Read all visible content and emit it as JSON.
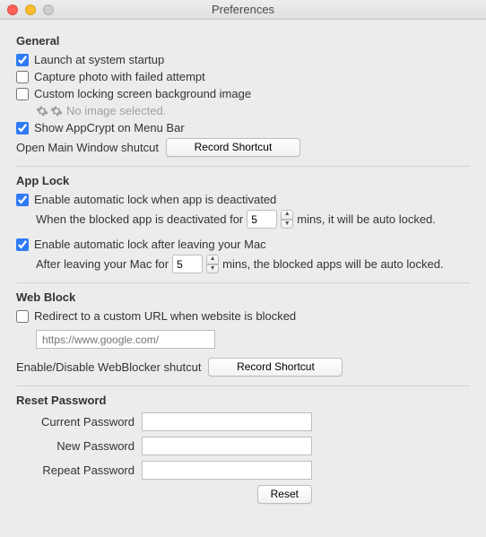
{
  "window": {
    "title": "Preferences"
  },
  "general": {
    "heading": "General",
    "launch": {
      "label": "Launch at system startup",
      "checked": true
    },
    "capture": {
      "label": "Capture photo with failed attempt",
      "checked": false
    },
    "customBg": {
      "label": "Custom locking screen background image",
      "checked": false
    },
    "noImage": "No image selected.",
    "menuBar": {
      "label": "Show AppCrypt on Menu Bar",
      "checked": true
    },
    "openShortcutLabel": "Open Main Window shutcut",
    "recordShortcut": "Record Shortcut"
  },
  "appLock": {
    "heading": "App Lock",
    "auto1": {
      "label": "Enable automatic lock when app is deactivated",
      "checked": true
    },
    "auto1_pre": "When the blocked app is deactivated for",
    "auto1_val": "5",
    "auto1_post": "mins, it will be auto locked.",
    "auto2": {
      "label": "Enable automatic lock after leaving your Mac",
      "checked": true
    },
    "auto2_pre": "After leaving your Mac for",
    "auto2_val": "5",
    "auto2_post": "mins, the blocked apps will be auto locked."
  },
  "webBlock": {
    "heading": "Web Block",
    "redirect": {
      "label": "Redirect to a custom URL when website is blocked",
      "checked": false
    },
    "urlPlaceholder": "https://www.google.com/",
    "shortcutLabel": "Enable/Disable WebBlocker shutcut",
    "recordShortcut": "Record Shortcut"
  },
  "reset": {
    "heading": "Reset Password",
    "current": "Current Password",
    "new": "New Password",
    "repeat": "Repeat Password",
    "button": "Reset"
  }
}
